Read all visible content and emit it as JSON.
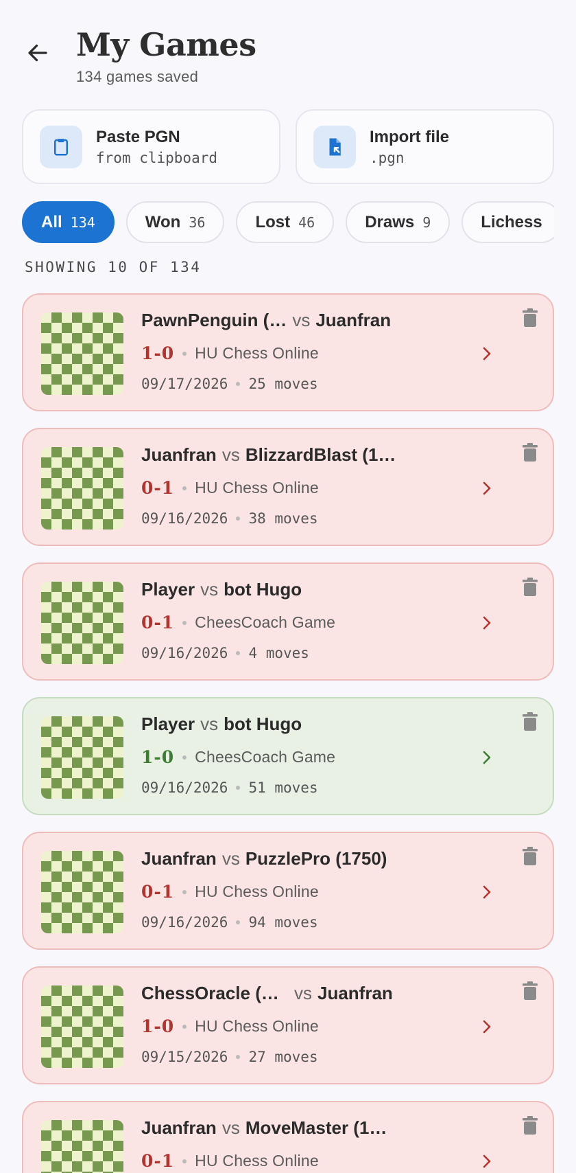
{
  "header": {
    "title": "My Games",
    "subtitle": "134 games saved"
  },
  "import": [
    {
      "title": "Paste PGN",
      "subtitle": "from clipboard",
      "icon": "clipboard-icon"
    },
    {
      "title": "Import file",
      "subtitle": ".pgn",
      "icon": "file-import-icon"
    }
  ],
  "filters": [
    {
      "label": "All",
      "count": "134",
      "active": true
    },
    {
      "label": "Won",
      "count": "36"
    },
    {
      "label": "Lost",
      "count": "46"
    },
    {
      "label": "Draws",
      "count": "9"
    },
    {
      "label": "Lichess",
      "count": ""
    }
  ],
  "showing": "SHOWING 10 OF 134",
  "games": [
    {
      "white": "PawnPenguin (…",
      "vs": "vs",
      "black": "Juanfran",
      "result": "1-0",
      "source": "HU Chess Online",
      "date": "09/17/2026",
      "moves": "25 moves",
      "status": "lost"
    },
    {
      "white": "Juanfran",
      "vs": "vs",
      "black": "BlizzardBlast (1…",
      "result": "0-1",
      "source": "HU Chess Online",
      "date": "09/16/2026",
      "moves": "38 moves",
      "status": "lost"
    },
    {
      "white": "Player",
      "vs": "vs",
      "black": "bot Hugo",
      "result": "0-1",
      "source": "CheesCoach Game",
      "date": "09/16/2026",
      "moves": "4 moves",
      "status": "lost"
    },
    {
      "white": "Player",
      "vs": "vs",
      "black": "bot Hugo",
      "result": "1-0",
      "source": "CheesCoach Game",
      "date": "09/16/2026",
      "moves": "51 moves",
      "status": "won"
    },
    {
      "white": "Juanfran",
      "vs": "vs",
      "black": "PuzzlePro (1750)",
      "result": "0-1",
      "source": "HU Chess Online",
      "date": "09/16/2026",
      "moves": "94 moves",
      "status": "lost"
    },
    {
      "white": "ChessOracle (1…",
      "vs": "vs",
      "black": "Juanfran",
      "result": "1-0",
      "source": "HU Chess Online",
      "date": "09/15/2026",
      "moves": "27 moves",
      "status": "lost"
    },
    {
      "white": "Juanfran",
      "vs": "vs",
      "black": "MoveMaster (1…",
      "result": "0-1",
      "source": "HU Chess Online",
      "date": "",
      "moves": "",
      "status": "lost"
    }
  ],
  "colors": {
    "accent": "#1c73d1",
    "lost_bg": "#fbe5e4",
    "won_bg": "#e8f1e3",
    "board_light": "#eef2cd",
    "board_dark": "#77994f"
  }
}
